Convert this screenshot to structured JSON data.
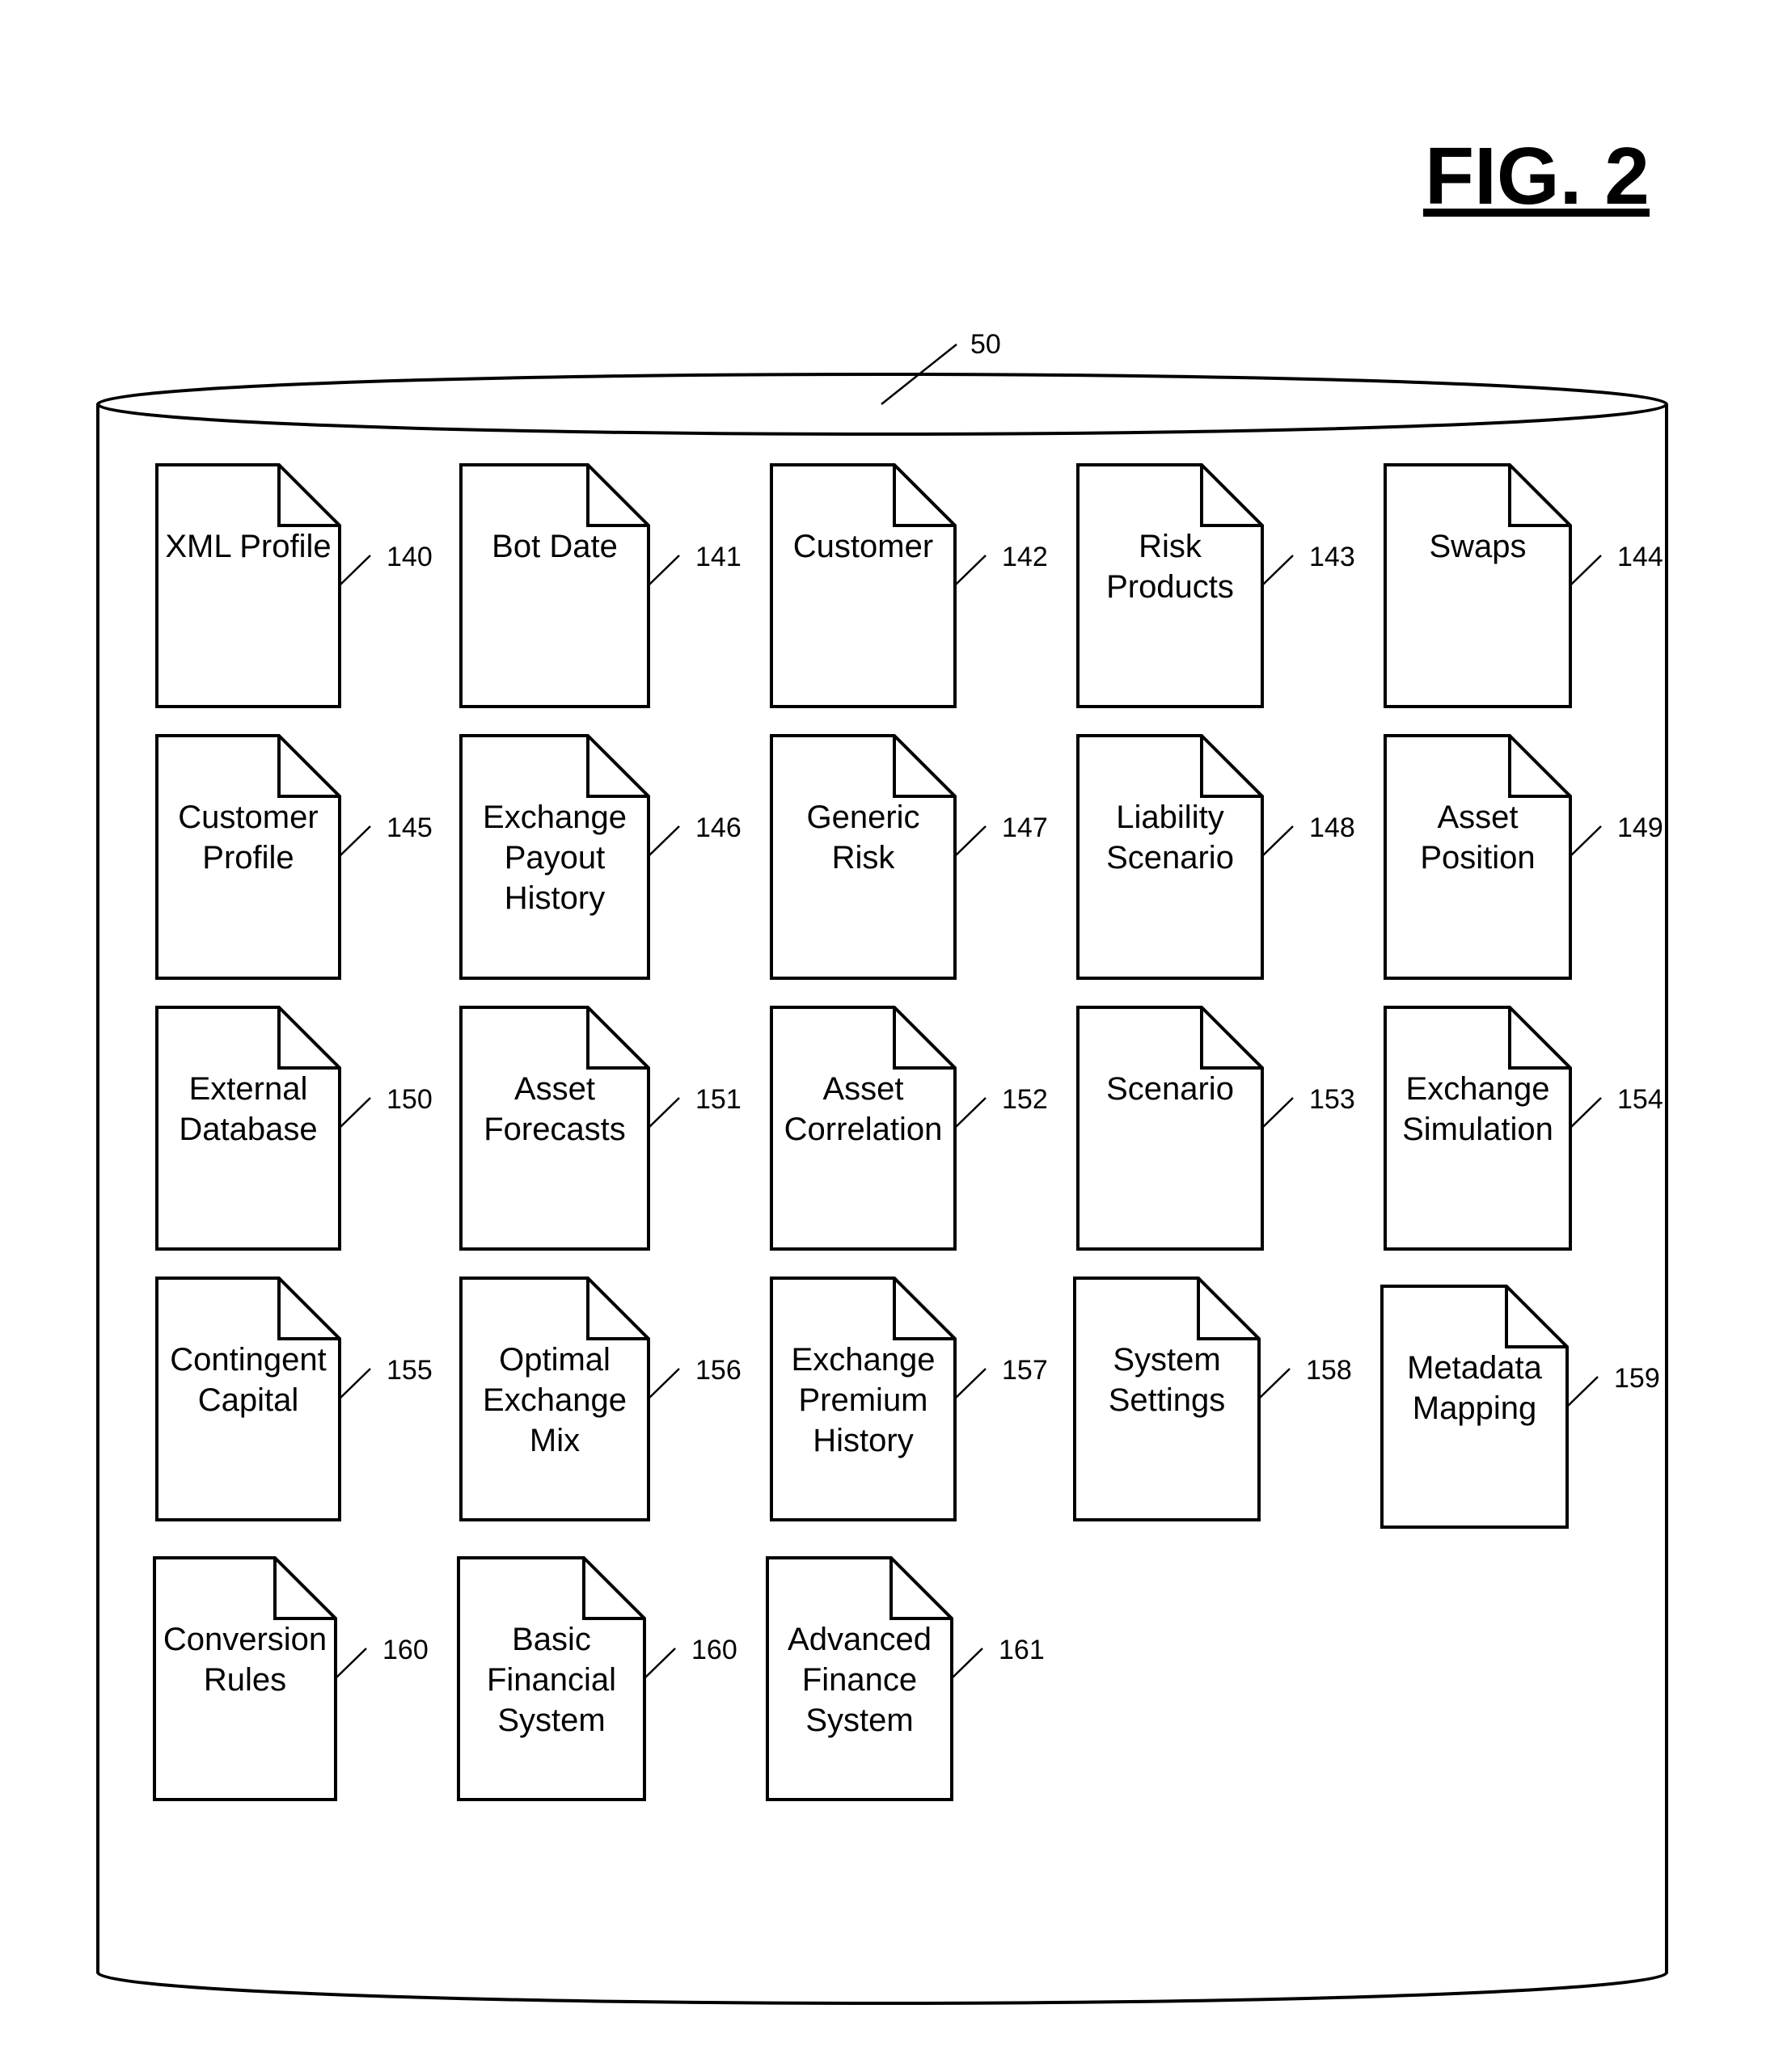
{
  "figure": {
    "title": "FIG. 2",
    "database_ref": "50"
  },
  "documents": [
    {
      "ref": "140",
      "lines": [
        "XML Profile"
      ]
    },
    {
      "ref": "141",
      "lines": [
        "Bot Date"
      ]
    },
    {
      "ref": "142",
      "lines": [
        "Customer"
      ]
    },
    {
      "ref": "143",
      "lines": [
        "Risk",
        "Products"
      ]
    },
    {
      "ref": "144",
      "lines": [
        "Swaps"
      ]
    },
    {
      "ref": "145",
      "lines": [
        "Customer",
        "Profile"
      ]
    },
    {
      "ref": "146",
      "lines": [
        "Exchange",
        "Payout",
        "History"
      ]
    },
    {
      "ref": "147",
      "lines": [
        "Generic",
        "Risk"
      ]
    },
    {
      "ref": "148",
      "lines": [
        "Liability",
        "Scenario"
      ]
    },
    {
      "ref": "149",
      "lines": [
        "Asset",
        "Position"
      ]
    },
    {
      "ref": "150",
      "lines": [
        "External",
        "Database"
      ]
    },
    {
      "ref": "151",
      "lines": [
        "Asset",
        "Forecasts"
      ]
    },
    {
      "ref": "152",
      "lines": [
        "Asset",
        "Correlation"
      ]
    },
    {
      "ref": "153",
      "lines": [
        "Scenario"
      ]
    },
    {
      "ref": "154",
      "lines": [
        "Exchange",
        "Simulation"
      ]
    },
    {
      "ref": "155",
      "lines": [
        "Contingent",
        "Capital"
      ]
    },
    {
      "ref": "156",
      "lines": [
        "Optimal",
        "Exchange",
        "Mix"
      ]
    },
    {
      "ref": "157",
      "lines": [
        "Exchange",
        "Premium",
        "History"
      ]
    },
    {
      "ref": "158",
      "lines": [
        "System",
        "Settings"
      ]
    },
    {
      "ref": "159",
      "lines": [
        "Metadata",
        "Mapping"
      ]
    },
    {
      "ref": "160",
      "lines": [
        "Conversion",
        "Rules"
      ]
    },
    {
      "ref": "160",
      "lines": [
        "Basic",
        "Financial",
        "System"
      ]
    },
    {
      "ref": "161",
      "lines": [
        "Advanced",
        "Finance",
        "System"
      ]
    }
  ]
}
